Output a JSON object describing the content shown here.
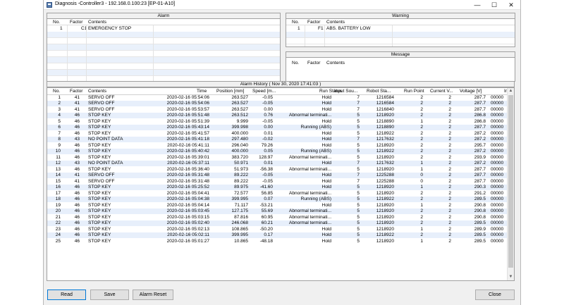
{
  "window": {
    "title": "Diagnosis -Controller3 - 192.168.0.100:23  [EP-01-A10]",
    "minimize_glyph": "—",
    "maximize_glyph": "☐",
    "close_glyph": "✕"
  },
  "alarm": {
    "header": "Alarm",
    "columns": [
      "No.",
      "Factor",
      "Contents"
    ],
    "rows": [
      {
        "no": "1",
        "factor": "C1",
        "contents": "EMERGENCY STOP"
      }
    ]
  },
  "warning": {
    "header": "Warning",
    "columns": [
      "No.",
      "Factor",
      "Contents"
    ],
    "rows": [
      {
        "no": "1",
        "factor": "F1",
        "contents": "ABS. BATTERY LOW"
      }
    ]
  },
  "message": {
    "header": "Message",
    "columns": [
      "No.",
      "Factor",
      "Contents"
    ]
  },
  "history": {
    "header": "Alarm History ( Nov 30, 2020 17:41:03 )",
    "columns": [
      "No.",
      "Factor",
      "Contents",
      "Time",
      "Position [mm]",
      "Speed [m...",
      "Run Status",
      "Input Sou...",
      "Robot Sta...",
      "Run Point",
      "Current V...",
      "Voltage [V]",
      "In"
    ],
    "rows": [
      [
        "1",
        "41",
        "SERVO OFF",
        "2020-02-16 05:54:06",
        "263.527",
        "-0.05",
        "Hold",
        "7",
        "1216584",
        "2",
        "2",
        "287.7",
        "00000"
      ],
      [
        "2",
        "41",
        "SERVO OFF",
        "2020-02-16 05:54:06",
        "263.527",
        "-0.05",
        "Hold",
        "7",
        "1216584",
        "2",
        "2",
        "287.7",
        "00000"
      ],
      [
        "3",
        "41",
        "SERVO OFF",
        "2020-02-16 05:53:57",
        "263.527",
        "0.00",
        "Hold",
        "7",
        "1216840",
        "2",
        "2",
        "287.7",
        "00000"
      ],
      [
        "4",
        "46",
        "STOP KEY",
        "2020-02-16 05:51:48",
        "263.512",
        "0.76",
        "Abnormal terminati...",
        "5",
        "1218920",
        "2",
        "2",
        "286.8",
        "00000"
      ],
      [
        "5",
        "46",
        "STOP KEY",
        "2020-02-16 05:51:39",
        "9.999",
        "-0.05",
        "Hold",
        "5",
        "1218890",
        "1",
        "2",
        "286.8",
        "00000"
      ],
      [
        "6",
        "46",
        "STOP KEY",
        "2020-02-16 05:43:14",
        "399.998",
        "0.00",
        "Running (ABS)",
        "5",
        "1218890",
        "2",
        "2",
        "287.7",
        "00000"
      ],
      [
        "7",
        "46",
        "STOP KEY",
        "2020-02-16 05:41:57",
        "400.000",
        "0.01",
        "Hold",
        "5",
        "1218922",
        "2",
        "2",
        "287.2",
        "00000"
      ],
      [
        "8",
        "43",
        "NO POINT DATA",
        "2020-02-16 05:41:18",
        "297.480",
        "-0.02",
        "Hold",
        "7",
        "1217632",
        "2",
        "2",
        "287.2",
        "00000"
      ],
      [
        "9",
        "46",
        "STOP KEY",
        "2020-02-16 05:41:11",
        "296.040",
        "79.26",
        "Hold",
        "5",
        "1218920",
        "2",
        "2",
        "295.7",
        "00000"
      ],
      [
        "10",
        "46",
        "STOP KEY",
        "2020-02-16 05:40:42",
        "400.000",
        "0.05",
        "Running (ABS)",
        "5",
        "1218922",
        "2",
        "2",
        "287.2",
        "00000"
      ],
      [
        "11",
        "46",
        "STOP KEY",
        "2020-02-16 05:39:01",
        "383.720",
        "128.97",
        "Abnormal terminati...",
        "5",
        "1218920",
        "2",
        "2",
        "293.9",
        "00000"
      ],
      [
        "12",
        "43",
        "NO POINT DATA",
        "2020-02-16 05:37:11",
        "50.971",
        "0.01",
        "Hold",
        "7",
        "1217632",
        "1",
        "2",
        "287.2",
        "00000"
      ],
      [
        "13",
        "46",
        "STOP KEY",
        "2020-02-16 05:36:40",
        "51.973",
        "-56.38",
        "Abnormal terminati...",
        "5",
        "1218920",
        "1",
        "2",
        "287.7",
        "00000"
      ],
      [
        "14",
        "41",
        "SERVO OFF",
        "2020-02-16 05:31:48",
        "89.222",
        "-0.05",
        "Hold",
        "7",
        "1225288",
        "0",
        "2",
        "287.7",
        "00000"
      ],
      [
        "15",
        "41",
        "SERVO OFF",
        "2020-02-16 05:31:48",
        "89.222",
        "-0.05",
        "Hold",
        "7",
        "1225288",
        "0",
        "2",
        "287.7",
        "00000"
      ],
      [
        "16",
        "46",
        "STOP KEY",
        "2020-02-16 05:25:52",
        "89.975",
        "-41.60",
        "Hold",
        "5",
        "1218920",
        "1",
        "2",
        "290.3",
        "00000"
      ],
      [
        "17",
        "46",
        "STOP KEY",
        "2020-02-16 05:04:41",
        "72.577",
        "56.85",
        "Abnormal terminati...",
        "5",
        "1218920",
        "2",
        "2",
        "291.2",
        "00000"
      ],
      [
        "18",
        "46",
        "STOP KEY",
        "2020-02-16 05:04:38",
        "399.995",
        "0.07",
        "Running (ABS)",
        "5",
        "1218922",
        "2",
        "2",
        "289.5",
        "00000"
      ],
      [
        "19",
        "46",
        "STOP KEY",
        "2020-02-16 05:04:14",
        "71.117",
        "-53.21",
        "Hold",
        "5",
        "1218920",
        "1",
        "2",
        "290.8",
        "00000"
      ],
      [
        "20",
        "46",
        "STOP KEY",
        "2020-02-16 05:03:45",
        "127.175",
        "55.69",
        "Abnormal terminati...",
        "5",
        "1218920",
        "2",
        "2",
        "290.8",
        "00000"
      ],
      [
        "21",
        "46",
        "STOP KEY",
        "2020-02-16 05:03:15",
        "87.816",
        "60.95",
        "Abnormal terminati...",
        "5",
        "1218920",
        "2",
        "2",
        "290.8",
        "00000"
      ],
      [
        "22",
        "46",
        "STOP KEY",
        "2020-02-16 05:02:40",
        "246.068",
        "60.21",
        "Abnormal terminati...",
        "5",
        "1218920",
        "2",
        "2",
        "289.5",
        "00000"
      ],
      [
        "23",
        "46",
        "STOP KEY",
        "2020-02-16 05:02:13",
        "108.865",
        "-50.20",
        "Hold",
        "5",
        "1218920",
        "1",
        "2",
        "289.9",
        "00000"
      ],
      [
        "24",
        "46",
        "STOP KEY",
        "2020-02-16 05:02:11",
        "399.995",
        "0.17",
        "Hold",
        "5",
        "1218922",
        "2",
        "2",
        "289.5",
        "00000"
      ],
      [
        "25",
        "46",
        "STOP KEY",
        "2020-02-16 05:01:27",
        "10.865",
        "-48.18",
        "Hold",
        "5",
        "1218920",
        "1",
        "2",
        "289.5",
        "00000"
      ]
    ]
  },
  "buttons": {
    "read": "Read",
    "save": "Save",
    "alarm_reset": "Alarm Reset",
    "close": "Close"
  },
  "scroll": {
    "up": "▲",
    "down": "▼"
  }
}
